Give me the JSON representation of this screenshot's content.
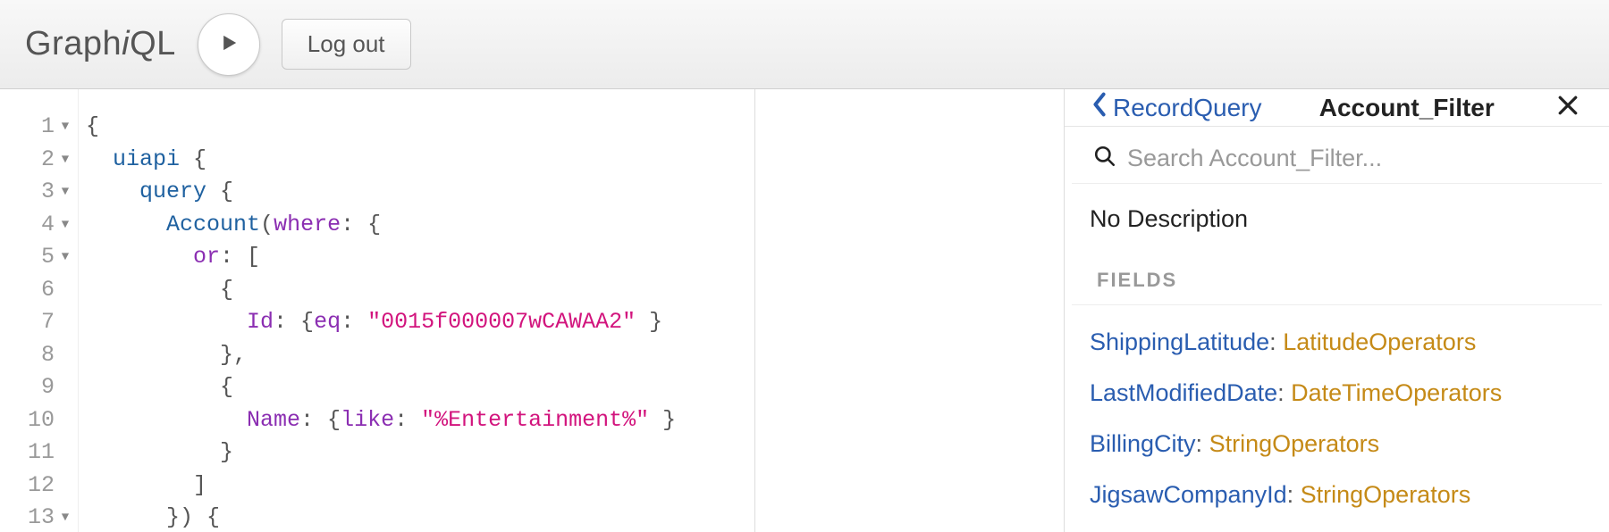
{
  "toolbar": {
    "logo_pre": "Graph",
    "logo_i": "i",
    "logo_post": "QL",
    "logout_label": "Log out"
  },
  "editor": {
    "lines": [
      {
        "n": 1,
        "fold": true,
        "tokens": [
          {
            "t": "{",
            "c": "punc"
          }
        ]
      },
      {
        "n": 2,
        "fold": true,
        "tokens": [
          {
            "t": "  ",
            "c": ""
          },
          {
            "t": "uiapi",
            "c": "field"
          },
          {
            "t": " {",
            "c": "punc"
          }
        ]
      },
      {
        "n": 3,
        "fold": true,
        "tokens": [
          {
            "t": "    ",
            "c": ""
          },
          {
            "t": "query",
            "c": "field"
          },
          {
            "t": " {",
            "c": "punc"
          }
        ]
      },
      {
        "n": 4,
        "fold": true,
        "tokens": [
          {
            "t": "      ",
            "c": ""
          },
          {
            "t": "Account",
            "c": "field"
          },
          {
            "t": "(",
            "c": "punc"
          },
          {
            "t": "where",
            "c": "attr"
          },
          {
            "t": ": {",
            "c": "punc"
          }
        ]
      },
      {
        "n": 5,
        "fold": true,
        "tokens": [
          {
            "t": "        ",
            "c": ""
          },
          {
            "t": "or",
            "c": "attr"
          },
          {
            "t": ": [",
            "c": "punc"
          }
        ]
      },
      {
        "n": 6,
        "fold": false,
        "tokens": [
          {
            "t": "          {",
            "c": "punc"
          }
        ]
      },
      {
        "n": 7,
        "fold": false,
        "tokens": [
          {
            "t": "            ",
            "c": ""
          },
          {
            "t": "Id",
            "c": "attr"
          },
          {
            "t": ": {",
            "c": "punc"
          },
          {
            "t": "eq",
            "c": "attr"
          },
          {
            "t": ": ",
            "c": "punc"
          },
          {
            "t": "\"0015f000007wCAWAA2\"",
            "c": "str"
          },
          {
            "t": " }",
            "c": "punc"
          }
        ]
      },
      {
        "n": 8,
        "fold": false,
        "tokens": [
          {
            "t": "          },",
            "c": "punc"
          }
        ]
      },
      {
        "n": 9,
        "fold": false,
        "tokens": [
          {
            "t": "          {",
            "c": "punc"
          }
        ]
      },
      {
        "n": 10,
        "fold": false,
        "tokens": [
          {
            "t": "            ",
            "c": ""
          },
          {
            "t": "Name",
            "c": "attr"
          },
          {
            "t": ": {",
            "c": "punc"
          },
          {
            "t": "like",
            "c": "attr"
          },
          {
            "t": ": ",
            "c": "punc"
          },
          {
            "t": "\"%Entertainment%\"",
            "c": "str"
          },
          {
            "t": " }",
            "c": "punc"
          }
        ]
      },
      {
        "n": 11,
        "fold": false,
        "tokens": [
          {
            "t": "          }",
            "c": "punc"
          }
        ]
      },
      {
        "n": 12,
        "fold": false,
        "tokens": [
          {
            "t": "        ]",
            "c": "punc"
          }
        ]
      },
      {
        "n": 13,
        "fold": true,
        "tokens": [
          {
            "t": "      }) {",
            "c": "punc"
          }
        ]
      }
    ]
  },
  "doc": {
    "back_label": "RecordQuery",
    "title": "Account_Filter",
    "search_placeholder": "Search Account_Filter...",
    "description": "No Description",
    "fields_label": "FIELDS",
    "fields": [
      {
        "name": "ShippingLatitude",
        "type": "LatitudeOperators"
      },
      {
        "name": "LastModifiedDate",
        "type": "DateTimeOperators"
      },
      {
        "name": "BillingCity",
        "type": "StringOperators"
      },
      {
        "name": "JigsawCompanyId",
        "type": "StringOperators"
      }
    ]
  }
}
